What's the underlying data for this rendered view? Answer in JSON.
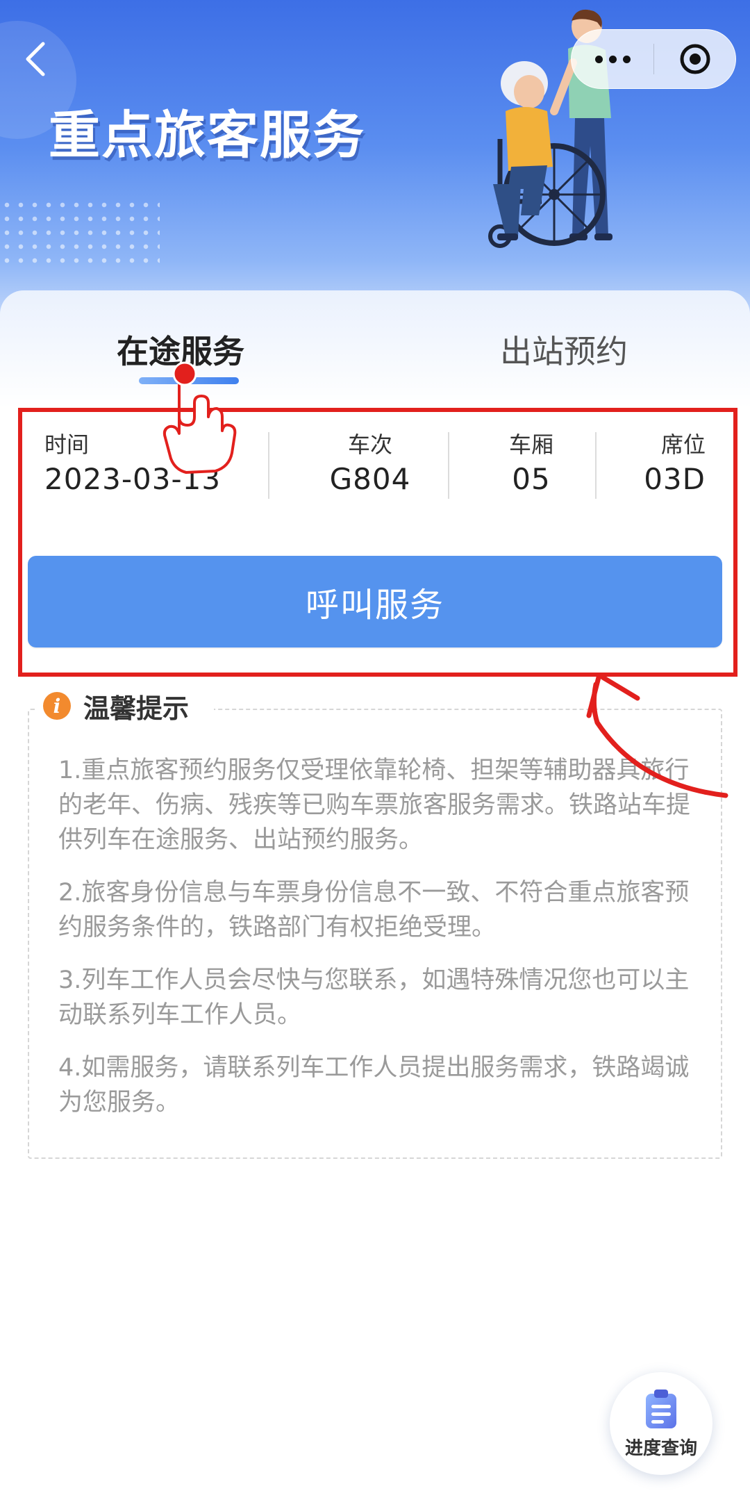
{
  "header": {
    "title": "重点旅客服务",
    "back_icon": "chevron-left-icon",
    "menu_icon": "more-dots-icon",
    "close_icon": "target-close-icon"
  },
  "tabs": [
    {
      "label": "在途服务",
      "active": true
    },
    {
      "label": "出站预约",
      "active": false
    }
  ],
  "ticket": {
    "date_label": "时间",
    "date_value": "2023-03-13",
    "train_label": "车次",
    "train_value": "G804",
    "car_label": "车厢",
    "car_value": "05",
    "seat_label": "席位",
    "seat_value": "03D"
  },
  "call_button": "呼叫服务",
  "tips": {
    "title": "温馨提示",
    "icon": "info-icon",
    "items": [
      "1.重点旅客预约服务仅受理依靠轮椅、担架等辅助器具旅行的老年、伤病、残疾等已购车票旅客服务需求。铁路站车提供列车在途服务、出站预约服务。",
      "2.旅客身份信息与车票身份信息不一致、不符合重点旅客预约服务条件的，铁路部门有权拒绝受理。",
      "3.列车工作人员会尽快与您联系，如遇特殊情况您也可以主动联系列车工作人员。",
      "4.如需服务，请联系列车工作人员提出服务需求，铁路竭诚为您服务。"
    ]
  },
  "progress_button": {
    "label": "进度查询",
    "icon": "clipboard-icon"
  },
  "colors": {
    "primary": "#5593ee",
    "annotation": "#e2201d",
    "tip_text": "#9a9a9a",
    "info_icon": "#f28a2e"
  }
}
